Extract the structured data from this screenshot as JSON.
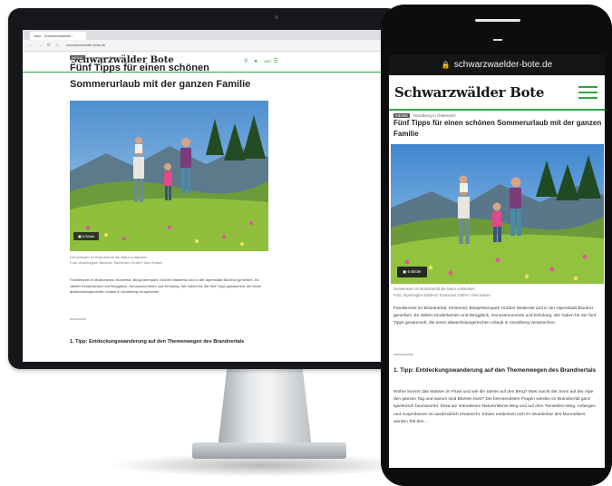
{
  "desktop": {
    "tab_label": "ratur - Schwarzwaelder...",
    "url": "schwarzwaelder-bote.de",
    "nav_icons": "← → ⟳ ⌂",
    "brand": "Schwarzwälder Bote",
    "action_abo": "ABO",
    "tag_badge": "MEINE",
    "tag_text": "Vorarlberg in Österreich",
    "title": "Fünf Tipps für einen schönen Sommerurlaub mit der ganzen Familie",
    "image_count": "6 Bilder",
    "caption_line1": "Gemeinsam im Brandnertal die Natur entdecken",
    "caption_line2": "Foto: Alpenregion Bludenz Tourismus GmbH / Alex Kaiser",
    "body": "Familienzeit im Brandnertal, Klostertal, Biosphärenpark Großes Walsertal und in der Alpenstadt Bludenz genießen. Es zählen Kinderlachen und Bergglück, Genussmomente und Erholung. Wir haben für Sie fünf Tipps gesammelt, die einen abwechslungsreichen Urlaub in Vorarlberg versprechen.",
    "section_title": "1. Tipp: Entdeckungswanderung auf den Themenwegen des Brandnertals"
  },
  "phone": {
    "url": "schwarzwaelder-bote.de",
    "brand": "Schwarzwälder Bote",
    "tag_badge": "MEINE",
    "tag_text": "Vorarlberg in Österreich",
    "title": "Fünf Tipps für einen schönen Sommerurlaub mit der ganzen Familie",
    "image_count": "6 Bilder",
    "caption_line1": "Gemeinsam im Brandnertal die Natur entdecken",
    "caption_line2": "Foto: Alpenregion Bludenz Tourismus GmbH / Alex Kaiser",
    "body": "Familienzeit im Brandnertal, Klostertal, Biosphärenpark Großes Walsertal und in der Alpenstadt Bludenz genießen. Es zählen Kinderlachen und Bergglück, Genussmomente und Erholung. Wir haben für Sie fünf Tipps gesammelt, die einen abwechslungsreichen Urlaub in Vorarlberg versprechen.",
    "section_title": "1. Tipp: Entdeckungswanderung auf den Themenwegen des Brandnertals",
    "section_body": "Woher kommt das Wasser im Fluss und wie die Steine auf den Berg? Was macht der Senn auf der Alpe den ganzen Tag und warum sind Blumen bunt? Die brennendsten Fragen werden im Brandnertal ganz spielerisch beantwortet. Etwa am interaktiven Naturerlebnis-Weg und auf dem Tierwelten-Weg. Anfangen und Ausprobieren ist ausdrücklich erwünscht. Kinder entdecken sich im Wunderbar des Murmeltiers werden Teil des..."
  },
  "icons": {
    "search": "search-icon",
    "user": "user-icon",
    "menu": "hamburger-menu-icon",
    "lock": "lock-icon",
    "camera": "camera-icon"
  },
  "colors": {
    "accent_green": "#35a244",
    "device_frame": "#16171a",
    "phone_frame": "#0d0d0f"
  }
}
